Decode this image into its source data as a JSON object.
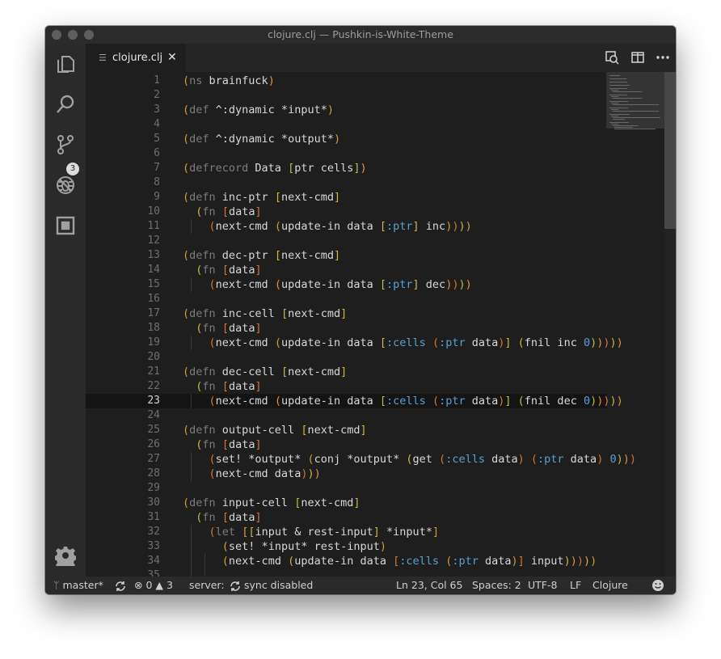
{
  "window": {
    "title": "clojure.clj — Pushkin-is-White-Theme"
  },
  "activity_bar": {
    "items": [
      {
        "name": "explorer",
        "icon": "files-icon"
      },
      {
        "name": "search",
        "icon": "search-icon"
      },
      {
        "name": "source-control",
        "icon": "source-control-icon",
        "badge": "3"
      },
      {
        "name": "debug",
        "icon": "debug-icon"
      },
      {
        "name": "extensions",
        "icon": "extensions-icon"
      }
    ],
    "settings_icon": "gear-icon"
  },
  "tab": {
    "label": "clojure.clj",
    "close_glyph": "✕"
  },
  "tab_actions": [
    "open-changes-icon",
    "split-editor-icon",
    "more-actions-icon"
  ],
  "editor": {
    "current_line": 23,
    "lines": [
      "(ns brainfuck)",
      "",
      "(def ^:dynamic *input*)",
      "",
      "(def ^:dynamic *output*)",
      "",
      "(defrecord Data [ptr cells])",
      "",
      "(defn inc-ptr [next-cmd]",
      "  (fn [data]",
      "    (next-cmd (update-in data [:ptr] inc))))",
      "",
      "(defn dec-ptr [next-cmd]",
      "  (fn [data]",
      "    (next-cmd (update-in data [:ptr] dec))))",
      "",
      "(defn inc-cell [next-cmd]",
      "  (fn [data]",
      "    (next-cmd (update-in data [:cells (:ptr data)] (fnil inc 0)))))",
      "",
      "(defn dec-cell [next-cmd]",
      "  (fn [data]",
      "    (next-cmd (update-in data [:cells (:ptr data)] (fnil dec 0)))))",
      "",
      "(defn output-cell [next-cmd]",
      "  (fn [data]",
      "    (set! *output* (conj *output* (get (:cells data) (:ptr data) 0)))",
      "    (next-cmd data)))",
      "",
      "(defn input-cell [next-cmd]",
      "  (fn [data]",
      "    (let [[input & rest-input] *input*]",
      "      (set! *input* rest-input)",
      "      (next-cmd (update-in data [:cells (:ptr data)] input)))))",
      ""
    ]
  },
  "status_bar": {
    "branch": "master*",
    "errors": "0",
    "warnings": "3",
    "server_label": "server:",
    "sync_label": "sync  disabled",
    "position": "Ln 23, Col 65",
    "spaces": "Spaces: 2",
    "encoding": "UTF-8",
    "eol": "LF",
    "language": "Clojure",
    "feedback_icon": "smiley-icon"
  },
  "colors": {
    "background": "#1e1e1e",
    "activity_bar": "#2a2a2a",
    "paren_level_1": "#d99a3a",
    "paren_level_2": "#cdb548",
    "paren_level_3": "#d27638",
    "keyword": "#5aa0d0",
    "special_form": "#7c7c7c"
  }
}
